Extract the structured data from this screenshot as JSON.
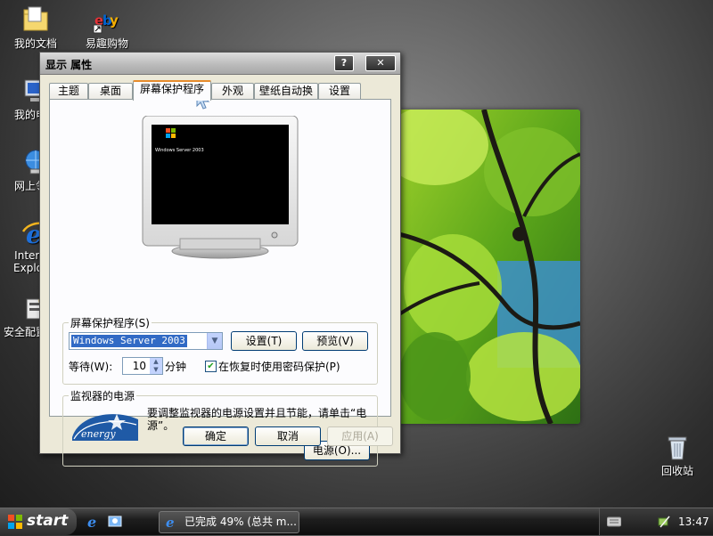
{
  "desktop": {
    "icons": [
      {
        "label": "我的文档"
      },
      {
        "label": "易趣购物"
      },
      {
        "label": "我的电脑"
      },
      {
        "label": "网上邻居"
      },
      {
        "label": "Internet Explorer"
      },
      {
        "label": "安全配置向导"
      },
      {
        "label": "回收站"
      }
    ]
  },
  "dialog": {
    "title": "显示 属性",
    "help_button": "?",
    "close_button": "✕",
    "tabs": [
      "主题",
      "桌面",
      "屏幕保护程序",
      "外观",
      "壁纸自动换",
      "设置"
    ],
    "active_tab": "屏幕保护程序",
    "preview_screen_text": "Windows Server 2003",
    "screensaver_group": {
      "legend": "屏幕保护程序(S)",
      "selected": "Windows Server 2003",
      "settings_button": "设置(T)",
      "preview_button": "预览(V)",
      "wait_label": "等待(W):",
      "wait_value": "10",
      "wait_unit": "分钟",
      "password_checkbox_label": "在恢复时使用密码保护(P)",
      "password_checked": true
    },
    "power_group": {
      "legend": "监视器的电源",
      "logo_text": "energy",
      "description": "要调整监视器的电源设置并且节能，请单击“电源”。",
      "power_button": "电源(O)..."
    },
    "ok_button": "确定",
    "cancel_button": "取消",
    "apply_button": "应用(A)"
  },
  "taskbar": {
    "start_label": "start",
    "task_label": "已完成 49% (总共 m...",
    "clock": "13:47"
  },
  "colors": {
    "dialog_bg": "#ece9d8",
    "tab_accent": "#e68b2c",
    "selection": "#316ac5"
  }
}
